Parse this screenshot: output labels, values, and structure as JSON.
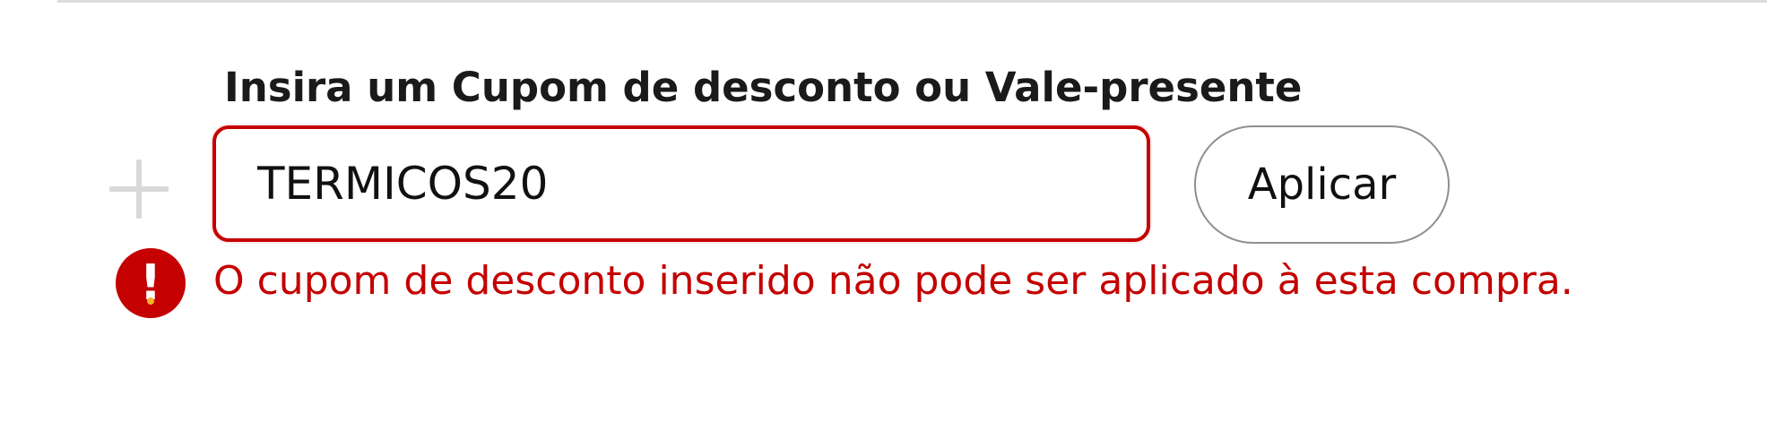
{
  "coupon_form": {
    "label": "Insira um Cupom de desconto ou Vale-presente",
    "input_value": "TERMICOS20",
    "apply_button_label": "Aplicar",
    "error_message": "O cupom de desconto inserido não pode ser aplicado à esta compra.",
    "icons": {
      "expand": "plus-icon",
      "error": "exclamation-icon"
    },
    "colors": {
      "error": "#c40000",
      "label": "#1a1a1a",
      "button_border": "#8f8f8f"
    }
  }
}
